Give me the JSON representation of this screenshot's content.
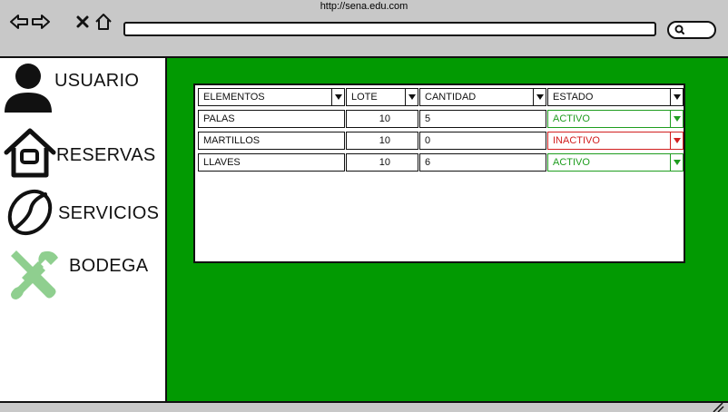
{
  "browser": {
    "url": "http://sena.edu.com"
  },
  "sidebar": {
    "items": [
      {
        "label": "USUARIO",
        "icon": "user-icon"
      },
      {
        "label": "RESERVAS",
        "icon": "home-icon"
      },
      {
        "label": "SERVICIOS",
        "icon": "coffee-bean-icon"
      },
      {
        "label": "BODEGA",
        "icon": "tools-icon"
      }
    ]
  },
  "table": {
    "headers": [
      "ELEMENTOS",
      "LOTE",
      "CANTIDAD",
      "ESTADO"
    ],
    "rows": [
      {
        "elemento": "PALAS",
        "lote": "10",
        "cantidad": "5",
        "estado": "ACTIVO"
      },
      {
        "elemento": "MARTILLOS",
        "lote": "10",
        "cantidad": "0",
        "estado": "INACTIVO"
      },
      {
        "elemento": "LLAVES",
        "lote": "10",
        "cantidad": "6",
        "estado": "ACTIVO"
      }
    ]
  },
  "colors": {
    "main_bg": "#029a02",
    "active": "#1f9d1f",
    "inactive": "#d21f1f",
    "bodega_icon": "#8fcf8f"
  }
}
